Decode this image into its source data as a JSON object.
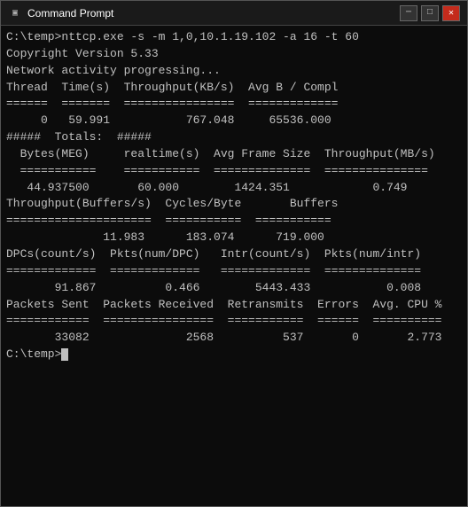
{
  "titleBar": {
    "title": "Command Prompt",
    "icon": "▣",
    "controls": {
      "minimize": "─",
      "maximize": "□",
      "close": "✕"
    }
  },
  "console": {
    "lines": [
      "C:\\temp>nttcp.exe -s -m 1,0,10.1.19.102 -a 16 -t 60",
      "Copyright Version 5.33",
      "Network activity progressing...",
      "",
      "Thread  Time(s)  Throughput(KB/s)  Avg B / Compl",
      "======  =======  ================  =============",
      "     0   59.991           767.048     65536.000",
      "",
      "",
      "#####  Totals:  #####",
      "",
      "",
      "  Bytes(MEG)     realtime(s)  Avg Frame Size  Throughput(MB/s)",
      "  ===========    ===========  ==============  ===============",
      "   44.937500       60.000        1424.351            0.749",
      "",
      "Throughput(Buffers/s)  Cycles/Byte       Buffers",
      "=====================  ===========  ===========",
      "              11.983      183.074      719.000",
      "",
      "DPCs(count/s)  Pkts(num/DPC)   Intr(count/s)  Pkts(num/intr)",
      "=============  =============   =============  ==============",
      "       91.867          0.466        5443.433           0.008",
      "",
      "Packets Sent  Packets Received  Retransmits  Errors  Avg. CPU %",
      "============  ================  ===========  ======  ==========",
      "       33082              2568          537       0       2.773",
      "",
      "C:\\temp>"
    ]
  }
}
